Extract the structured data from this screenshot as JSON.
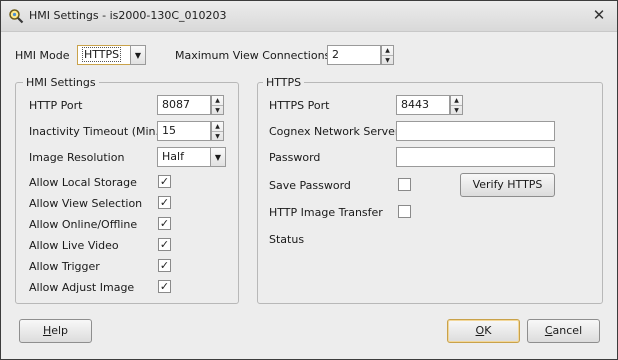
{
  "window": {
    "title": "HMI Settings - is2000-130C_010203"
  },
  "top": {
    "hmi_mode_label": "HMI Mode",
    "hmi_mode_value": "HTTPS",
    "max_view_label": "Maximum View Connections",
    "max_view_value": "2"
  },
  "hmi_settings": {
    "title": "HMI Settings",
    "http_port_label": "HTTP Port",
    "http_port_value": "8087",
    "timeout_label": "Inactivity Timeout (Min.)",
    "timeout_value": "15",
    "resolution_label": "Image Resolution",
    "resolution_value": "Half",
    "options": [
      {
        "label": "Allow Local Storage",
        "checked": true
      },
      {
        "label": "Allow View Selection",
        "checked": true
      },
      {
        "label": "Allow Online/Offline",
        "checked": true
      },
      {
        "label": "Allow Live Video",
        "checked": true
      },
      {
        "label": "Allow Trigger",
        "checked": true
      },
      {
        "label": "Allow Adjust Image",
        "checked": true
      }
    ]
  },
  "https": {
    "title": "HTTPS",
    "port_label": "HTTPS Port",
    "port_value": "8443",
    "server_label": "Cognex Network Server",
    "server_value": "",
    "password_label": "Password",
    "password_value": "",
    "save_password_label": "Save Password",
    "save_password_checked": false,
    "verify_button": "Verify HTTPS",
    "image_transfer_label": "HTTP Image Transfer",
    "image_transfer_checked": false,
    "status_label": "Status"
  },
  "buttons": {
    "help_hotkey": "H",
    "help_rest": "elp",
    "ok_hotkey": "O",
    "ok_rest": "K",
    "cancel_hotkey": "C",
    "cancel_rest": "ancel"
  },
  "icons": {
    "app": "magnifier-gear-icon",
    "close": "close-icon",
    "check": "✓",
    "spin_up": "▲",
    "spin_down": "▼",
    "dropdown": "▼"
  }
}
